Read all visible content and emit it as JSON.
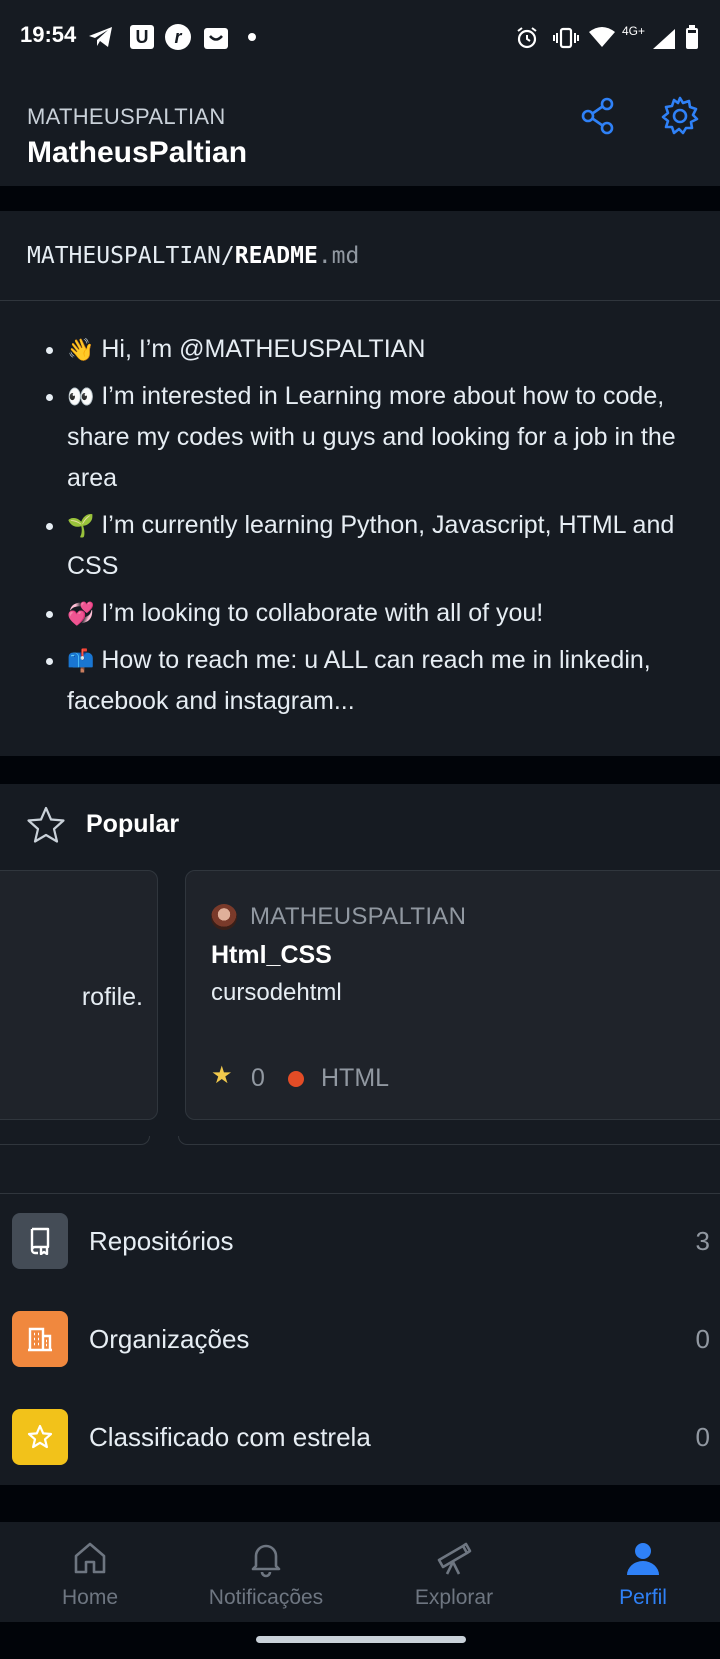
{
  "status_bar": {
    "time": "19:54",
    "network": "4G+"
  },
  "header": {
    "login": "MATHEUSPALTIAN",
    "name": "MatheusPaltian"
  },
  "readme": {
    "owner": "MATHEUSPALTIAN/",
    "file": "README",
    "ext": ".md",
    "items": [
      {
        "emoji": "👋",
        "text": "Hi, I’m @MATHEUSPALTIAN"
      },
      {
        "emoji": "👀",
        "text": "I’m interested in Learning more about how to code, share my codes with u guys and looking for a job in the area"
      },
      {
        "emoji": "🌱",
        "text": "I’m currently learning Python, Javascript, HTML and CSS"
      },
      {
        "emoji": "💞️",
        "text": "I’m looking to collaborate with all of you!"
      },
      {
        "emoji": "📫",
        "text": "How to reach me: u ALL can reach me in linkedin, facebook and instagram..."
      }
    ]
  },
  "popular": {
    "title": "Popular",
    "prev_card_text": "rofile.",
    "card": {
      "owner": "MATHEUSPALTIAN",
      "repo": "Html_CSS",
      "description": "cursodehtml",
      "stars": "0",
      "language": "HTML",
      "language_color": "#e34c26"
    }
  },
  "menu": [
    {
      "label": "Repositórios",
      "count": "3",
      "icon": "repo-icon",
      "color": "#444c56"
    },
    {
      "label": "Organizações",
      "count": "0",
      "icon": "organization-icon",
      "color": "#f0883e"
    },
    {
      "label": "Classificado com estrela",
      "count": "0",
      "icon": "star-icon",
      "color": "#f2c21a"
    }
  ],
  "nav": [
    {
      "label": "Home",
      "icon": "home-icon"
    },
    {
      "label": "Notificações",
      "icon": "bell-icon"
    },
    {
      "label": "Explorar",
      "icon": "telescope-icon"
    },
    {
      "label": "Perfil",
      "icon": "person-icon",
      "active": true
    }
  ],
  "colors": {
    "accent": "#2f81f7",
    "background": "#010409",
    "surface": "#161b22"
  }
}
